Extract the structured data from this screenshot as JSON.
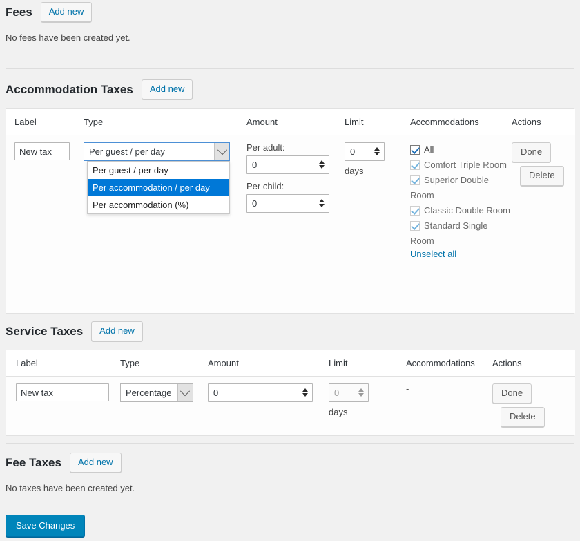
{
  "fees": {
    "title": "Fees",
    "add_new_label": "Add new",
    "empty_message": "No fees have been created yet."
  },
  "accommodation_taxes": {
    "title": "Accommodation Taxes",
    "add_new_label": "Add new",
    "columns": [
      "Label",
      "Type",
      "Amount",
      "Limit",
      "Accommodations",
      "Actions"
    ],
    "row": {
      "label_value": "New tax",
      "type": {
        "selected": "Per guest / per day",
        "open": true,
        "options": [
          "Per guest / per day",
          "Per accommodation / per day",
          "Per accommodation (%)"
        ],
        "highlighted_option": "Per accommodation / per day"
      },
      "amount": {
        "per_adult_label": "Per adult:",
        "per_adult_value": "0",
        "per_child_label": "Per child:",
        "per_child_value": "0"
      },
      "limit": {
        "value": "0",
        "unit": "days"
      },
      "accommodations": {
        "all_label": "All",
        "items": [
          "Comfort Triple Room",
          "Superior Double Room",
          "Classic Double Room",
          "Standard Single Room"
        ],
        "toggle_link": "Unselect all"
      },
      "actions": {
        "done_label": "Done",
        "delete_label": "Delete"
      }
    }
  },
  "service_taxes": {
    "title": "Service Taxes",
    "add_new_label": "Add new",
    "columns": [
      "Label",
      "Type",
      "Amount",
      "Limit",
      "Accommodations",
      "Actions"
    ],
    "row": {
      "label_value": "New tax",
      "type_selected": "Percentage",
      "amount_value": "0",
      "limit": {
        "value": "0",
        "unit": "days"
      },
      "accommodations_value": "-",
      "actions": {
        "done_label": "Done",
        "delete_label": "Delete"
      }
    }
  },
  "fee_taxes": {
    "title": "Fee Taxes",
    "add_new_label": "Add new",
    "empty_message": "No taxes have been created yet."
  },
  "footer": {
    "save_label": "Save Changes"
  },
  "colors": {
    "page_background": "#f1f1f1",
    "accent_link": "#0073aa",
    "save_button": "#0085ba",
    "dropdown_highlight": "#0078d7",
    "select_focus_border": "#4d90d6",
    "checkbox_check": "#1e6fb8",
    "checkbox_check_disabled": "#74b4de"
  }
}
